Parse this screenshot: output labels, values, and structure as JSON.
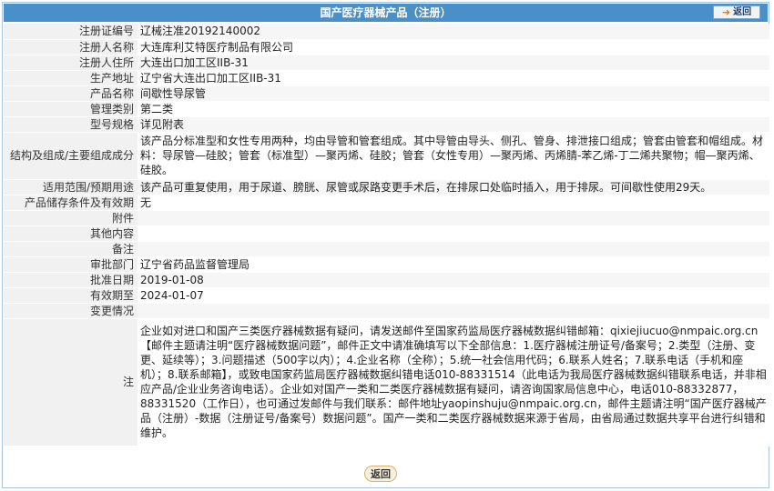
{
  "header": {
    "title": "国产医疗器械产品（注册）",
    "back_label": "返回"
  },
  "rows": [
    {
      "label": "注册证编号",
      "value": "辽械注准20192140002"
    },
    {
      "label": "注册人名称",
      "value": "大连库利艾特医疗制品有限公司"
    },
    {
      "label": "注册人住所",
      "value": "大连出口加工区IIB-31"
    },
    {
      "label": "生产地址",
      "value": "辽宁省大连出口加工区IIB-31"
    },
    {
      "label": "产品名称",
      "value": "间歇性导尿管"
    },
    {
      "label": "管理类别",
      "value": "第二类"
    },
    {
      "label": "型号规格",
      "value": "详见附表"
    },
    {
      "label": "结构及组成/主要组成成分",
      "value": "该产品分标准型和女性专用两种，均由导管和管套组成。其中导管由导头、侧孔、管身、排泄接口组成；管套由管套和帽组成。材料：导尿管—硅胶；管套（标准型）—聚丙烯、硅胶；管套（女性专用）—聚丙烯、丙烯腈-苯乙烯-丁二烯共聚物；帽—聚丙烯、硅胶。"
    },
    {
      "label": "适用范围/预期用途",
      "value": "该产品可重复使用，用于尿道、膀胱、尿管或尿路变更手术后，在排尿口处临时插入，用于排尿。可间歇性使用29天。"
    },
    {
      "label": "产品储存条件及有效期",
      "value": "无"
    },
    {
      "label": "附件",
      "value": ""
    },
    {
      "label": "其他内容",
      "value": ""
    },
    {
      "label": "备注",
      "value": ""
    },
    {
      "label": "审批部门",
      "value": "辽宁省药品监督管理局"
    },
    {
      "label": "批准日期",
      "value": "2019-01-08"
    },
    {
      "label": "有效期至",
      "value": "2024-01-07"
    },
    {
      "label": "变更情况",
      "value": ""
    },
    {
      "label": "注",
      "value": "企业如对进口和国产三类医疗器械数据有疑问，请发送邮件至国家药监局医疗器械数据纠错邮箱：qixiejiucuo@nmpaic.org.cn【邮件主题请注明“医疗器械数据问题”，邮件正文中请准确填写以下全部信息：1.医疗器械注册证号/备案号；2.类型（注册、变更、延续等）；3.问题描述（500字以内）；4.企业名称（全称）；5.统一社会信用代码；6.联系人姓名；7.联系电话（手机和座机）；8.联系邮箱】，或致电国家药监局医疗器械数据纠错电话010-88331514（此电话为我局医疗器械数据纠错联系电话，并非相应产品/企业业务咨询电话）。企业如对国产一类和二类医疗器械数据有疑问，请咨询国家局信息中心，电话010-88332877，88331520（工作日），也可通过发邮件与我们联系：邮件地址yaopinshuju@nmpaic.org.cn，邮件主题请注明“国产医疗器械产品（注册）-数据（注册证号/备案号）数据问题”。国产一类和二类医疗器械数据来源于省局，由省局通过数据共享平台进行纠错和维护。"
    }
  ],
  "footer": {
    "back_label": "返回"
  }
}
